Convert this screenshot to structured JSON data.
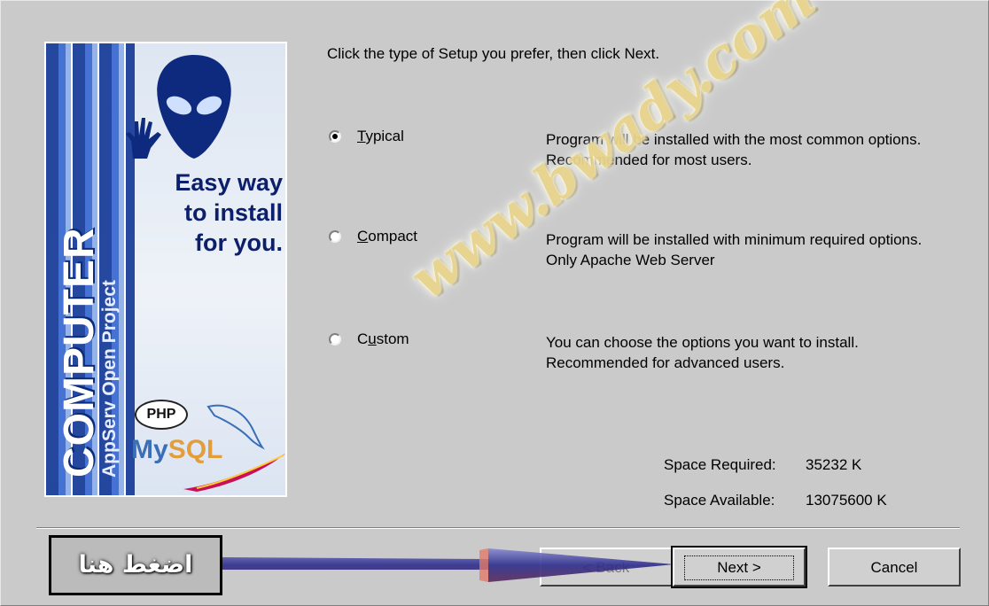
{
  "instruction": "Click the type of Setup you prefer, then click Next.",
  "banner": {
    "vertical_title": "COMPUTER",
    "vertical_subtitle": "AppServ Open Project",
    "slogan": [
      "Easy way",
      "to install",
      "for you."
    ],
    "php_label": "PHP",
    "mysql_my": "My",
    "mysql_sql": "SQL"
  },
  "options": [
    {
      "id": "typical",
      "label": "Typical",
      "accel": "T",
      "rest": "ypical",
      "checked": true,
      "description": "Program will be installed with the most common options. Recommended for most users."
    },
    {
      "id": "compact",
      "label": "Compact",
      "accel": "C",
      "rest": "ompact",
      "checked": false,
      "description": "Program will be installed with minimum required options.\nOnly Apache Web Server"
    },
    {
      "id": "custom",
      "label": "Custom",
      "accel": "u",
      "pre": "C",
      "rest": "stom",
      "checked": false,
      "description": "You can choose the options you want to install. Recommended for advanced users."
    }
  ],
  "space": {
    "required_label": "Space Required:",
    "required_value": "35232 K",
    "available_label": "Space Available:",
    "available_value": "13075600 K"
  },
  "buttons": {
    "back": "< Back",
    "next": "Next >",
    "cancel": "Cancel"
  },
  "annotation": {
    "arabic_label": "اضغط هنا",
    "watermark": "www.bwady.com"
  },
  "colors": {
    "dialog_bg": "#cacaca",
    "banner_blue": "#1b3f9a",
    "watermark": "#e9d58e",
    "arrow": "#3a3a9a"
  }
}
